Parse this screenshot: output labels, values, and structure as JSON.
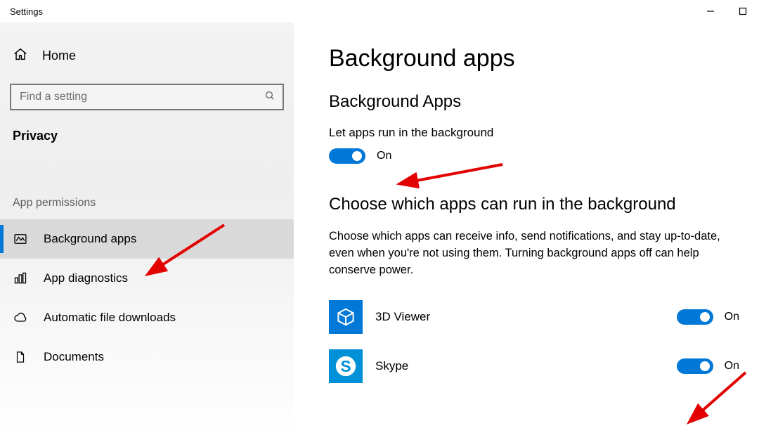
{
  "window": {
    "title": "Settings"
  },
  "sidebar": {
    "home": "Home",
    "search_placeholder": "Find a setting",
    "category": "Privacy",
    "group_label": "App permissions",
    "items": [
      {
        "label": "Background apps"
      },
      {
        "label": "App diagnostics"
      },
      {
        "label": "Automatic file downloads"
      },
      {
        "label": "Documents"
      }
    ]
  },
  "page": {
    "title": "Background apps",
    "section1_title": "Background Apps",
    "master_label": "Let apps run in the background",
    "master_state": "On",
    "section2_title": "Choose which apps can run in the background",
    "section2_desc": "Choose which apps can receive info, send notifications, and stay up-to-date, even when you're not using them. Turning background apps off can help conserve power.",
    "apps": [
      {
        "name": "3D Viewer",
        "state": "On"
      },
      {
        "name": "Skype",
        "state": "On"
      }
    ]
  },
  "colors": {
    "accent": "#0078d7"
  }
}
